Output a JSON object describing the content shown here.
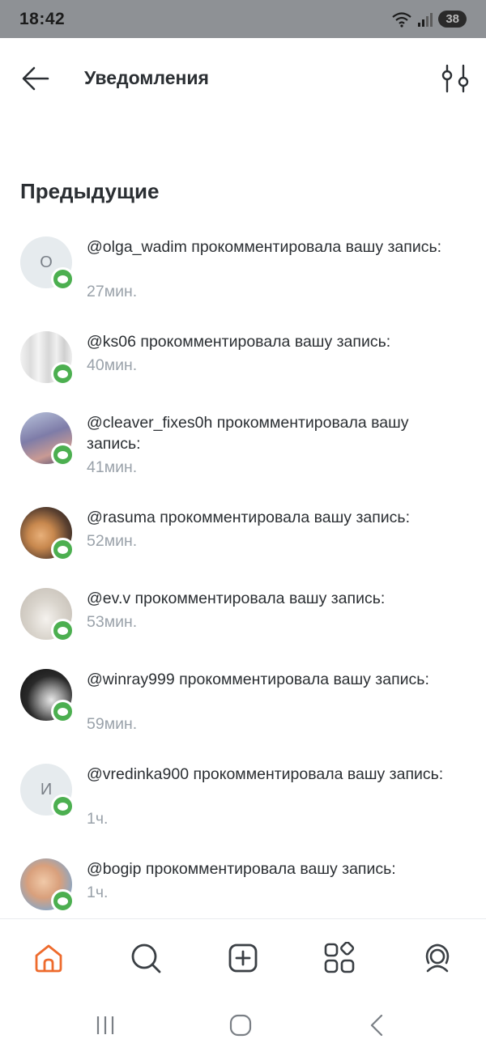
{
  "status_bar": {
    "time": "18:42",
    "battery": "38",
    "icons": [
      "wifi-icon",
      "signal-icon",
      "battery-icon"
    ]
  },
  "header": {
    "title": "Уведомления",
    "back_icon": "back-arrow-icon",
    "filter_icon": "filter-sliders-icon"
  },
  "section": {
    "title": "Предыдущие"
  },
  "notifications": [
    {
      "text": "@olga_wadim прокомментировала вашу запись:",
      "time": "27мин.",
      "avatar_letter": "О",
      "badge_icon": "comment-icon"
    },
    {
      "text": "@ks06 прокомментировала вашу запись:",
      "time": "40мин.",
      "avatar_letter": "",
      "badge_icon": "comment-icon"
    },
    {
      "text": "@cleaver_fixes0h прокомментировала вашу запись:",
      "time": "41мин.",
      "avatar_letter": "",
      "badge_icon": "comment-icon"
    },
    {
      "text": "@rasuma прокомментировала вашу запись:",
      "time": "52мин.",
      "avatar_letter": "",
      "badge_icon": "comment-icon"
    },
    {
      "text": "@ev.v прокомментировала вашу запись:",
      "time": "53мин.",
      "avatar_letter": "",
      "badge_icon": "comment-icon"
    },
    {
      "text": "@winray999 прокомментировала вашу запись:",
      "time": "59мин.",
      "avatar_letter": "",
      "badge_icon": "comment-icon"
    },
    {
      "text": "@vredinka900 прокомментировала вашу запись:",
      "time": "1ч.",
      "avatar_letter": "И",
      "badge_icon": "comment-icon"
    },
    {
      "text": "@bogip прокомментировала вашу запись:",
      "time": "1ч.",
      "avatar_letter": "",
      "badge_icon": "comment-icon"
    }
  ],
  "bottom_nav": {
    "items": [
      "home-icon",
      "search-icon",
      "add-post-icon",
      "services-icon",
      "profile-icon"
    ],
    "active": "home-icon",
    "active_color": "#ee6b2d",
    "inactive_color": "#3a3f44"
  },
  "system_nav": {
    "items": [
      "recents-icon",
      "home-circle-icon",
      "back-chevron-icon"
    ]
  },
  "colors": {
    "badge_green": "#4caf50",
    "time_gray": "#9aa2aa",
    "status_bar_bg": "#8e9195"
  }
}
